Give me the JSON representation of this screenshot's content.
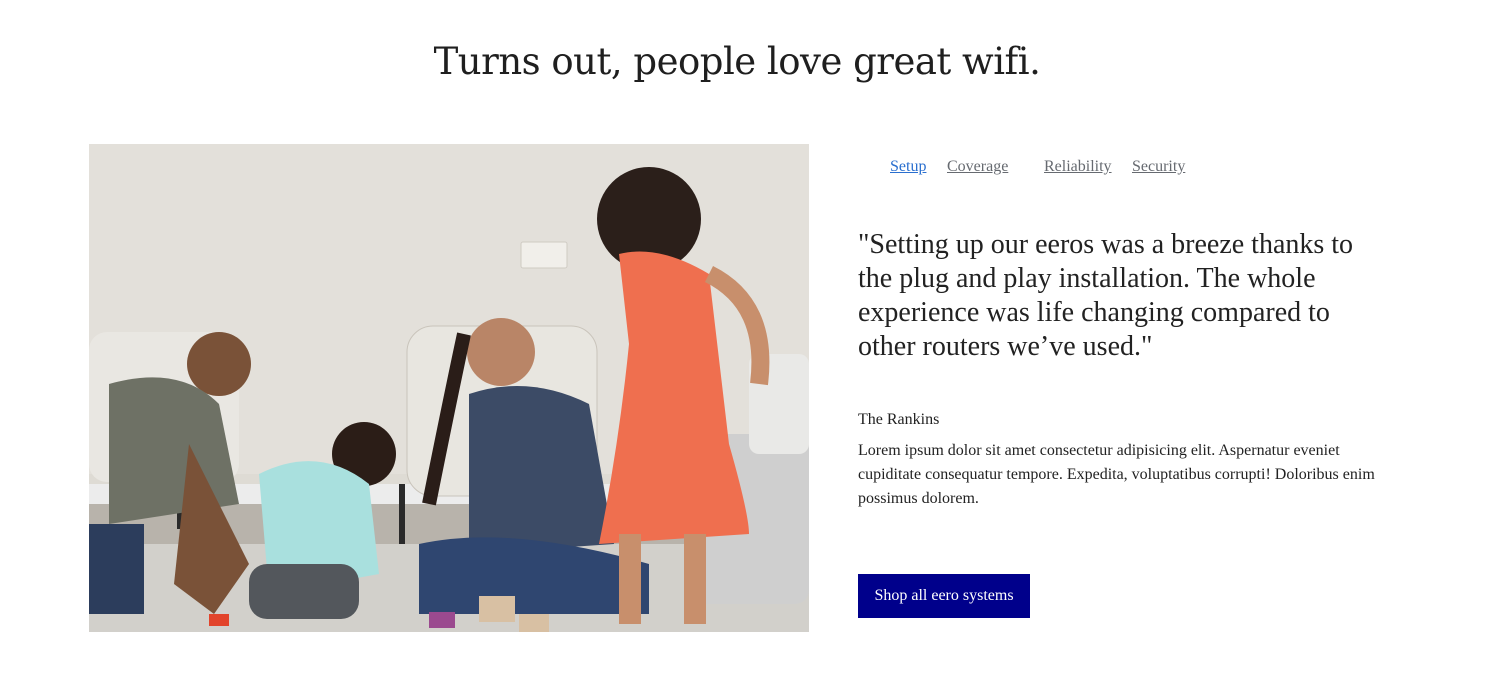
{
  "headline": "Turns out, people love great wifi.",
  "photo": {
    "alt": "Family playing with toys on the living room floor"
  },
  "tabs": [
    {
      "label": "Setup",
      "active": true
    },
    {
      "label": "Coverage",
      "active": false
    },
    {
      "label": "Reliability",
      "active": false
    },
    {
      "label": "Security",
      "active": false
    }
  ],
  "testimonial": {
    "quote": "\"Setting up our eeros was a breeze thanks to the plug and play installation. The whole experience was life changing compared to other routers we’ve used.\"",
    "author": "The Rankins",
    "body": "Lorem ipsum dolor sit amet consectetur adipisicing elit. Aspernatur eveniet cupiditate consequatur tempore. Expedita, voluptatibus corrupti! Doloribus enim possimus dolorem."
  },
  "cta": {
    "label": "Shop all eero systems"
  },
  "colors": {
    "cta_background": "#00008b",
    "tab_active": "#2a6fcf",
    "tab_inactive": "#666a70",
    "text": "#222222"
  }
}
